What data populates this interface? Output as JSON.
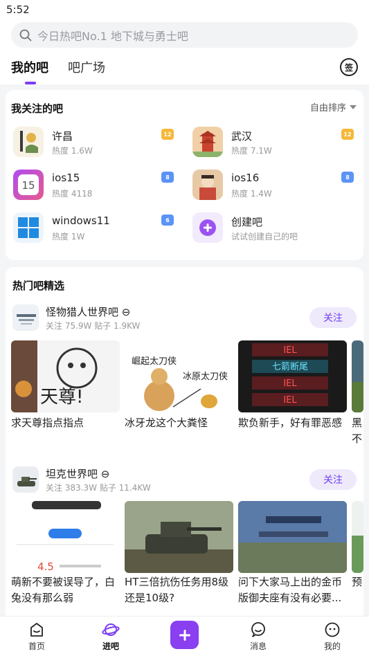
{
  "status": {
    "time": "5:52"
  },
  "search": {
    "placeholder": "今日热吧No.1 地下城与勇士吧"
  },
  "tabs": [
    {
      "label": "我的吧"
    },
    {
      "label": "吧广场"
    }
  ],
  "sign": {
    "label": "签"
  },
  "followed": {
    "title": "我关注的吧",
    "sort_label": "自由排序",
    "items": [
      {
        "name": "许昌",
        "heat": "热度 1.6W",
        "level": "12"
      },
      {
        "name": "武汉",
        "heat": "热度 7.1W",
        "level": "12"
      },
      {
        "name": "ios15",
        "heat": "热度 4118",
        "level": "8"
      },
      {
        "name": "ios16",
        "heat": "热度 1.4W",
        "level": "8"
      },
      {
        "name": "windows11",
        "heat": "热度 1W",
        "level": "6"
      },
      {
        "name": "创建吧",
        "heat": "试试创建自己的吧"
      }
    ]
  },
  "hot": {
    "title": "热门吧精选",
    "groups": [
      {
        "name": "怪物猎人世界吧 ⊖",
        "stats": "关注 75.9W   贴子 1.9KW",
        "follow_label": "关注",
        "posts": [
          {
            "caption": "求天尊指点指点",
            "thumb_text": "天尊!"
          },
          {
            "caption": "冰牙龙这个大粪怪",
            "thumb_text_1": "崛起太刀侠",
            "thumb_text_2": "冰原太刀侠"
          },
          {
            "caption": "欺负新手，好有罪恶感",
            "thumb_rows": [
              "IEL",
              "七箭断尾",
              "IEL",
              "IEL"
            ]
          },
          {
            "caption": "黑 不"
          }
        ]
      },
      {
        "name": "坦克世界吧 ⊖",
        "stats": "关注 383.3W   贴子 11.4KW",
        "follow_label": "关注",
        "posts": [
          {
            "caption": "萌新不要被误导了，白兔没有那么弱",
            "thumb_score": "4.5"
          },
          {
            "caption": "HT三倍抗伤任务用8级还是10级?"
          },
          {
            "caption": "问下大家马上出的金币版御夫座有没有必要..."
          },
          {
            "caption": "预"
          }
        ]
      }
    ]
  },
  "nav": [
    {
      "label": "首页"
    },
    {
      "label": "进吧"
    },
    {
      "label": "消息"
    },
    {
      "label": "我的"
    }
  ],
  "colors": {
    "accent": "#7b3cf5",
    "follow_bg": "#efeafb",
    "level_gold": "#f5b83a",
    "level_blue": "#5b93f7"
  }
}
